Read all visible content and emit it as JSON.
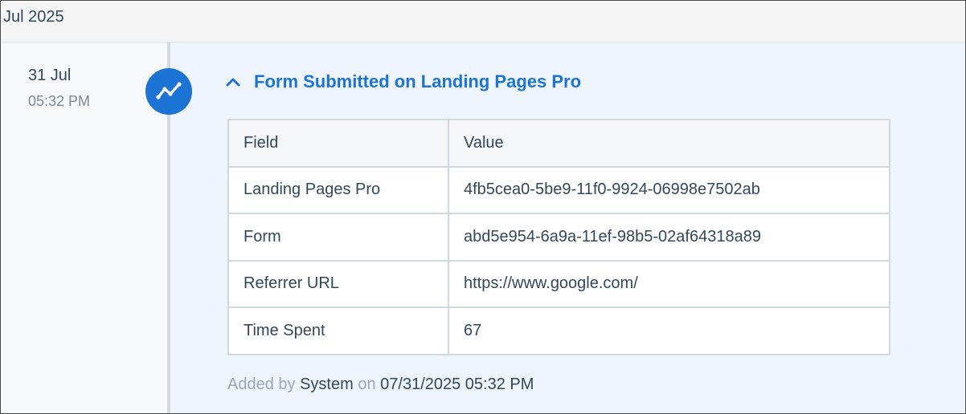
{
  "month_header": "Jul 2025",
  "event": {
    "date_day": "31 Jul",
    "date_time": "05:32 PM",
    "icon": "trend-line-icon",
    "toggle_icon": "chevron-up-icon",
    "title": "Form Submitted on Landing Pages Pro",
    "table": {
      "headers": [
        "Field",
        "Value"
      ],
      "rows": [
        [
          "Landing Pages Pro",
          "4fb5cea0-5be9-11f0-9924-06998e7502ab"
        ],
        [
          "Form",
          "abd5e954-6a9a-11ef-98b5-02af64318a89"
        ],
        [
          "Referrer URL",
          "https://www.google.com/"
        ],
        [
          "Time Spent",
          "67"
        ]
      ]
    },
    "footer": {
      "added_by_label": "Added by",
      "added_by_value": "System",
      "on_label": "on",
      "on_value": "07/31/2025 05:32 PM"
    }
  },
  "colors": {
    "accent": "#1b74d4",
    "content_background": "#eef5fd",
    "header_background": "#f5f5f5",
    "text": "#33475b",
    "muted_text": "#99a6b4"
  }
}
